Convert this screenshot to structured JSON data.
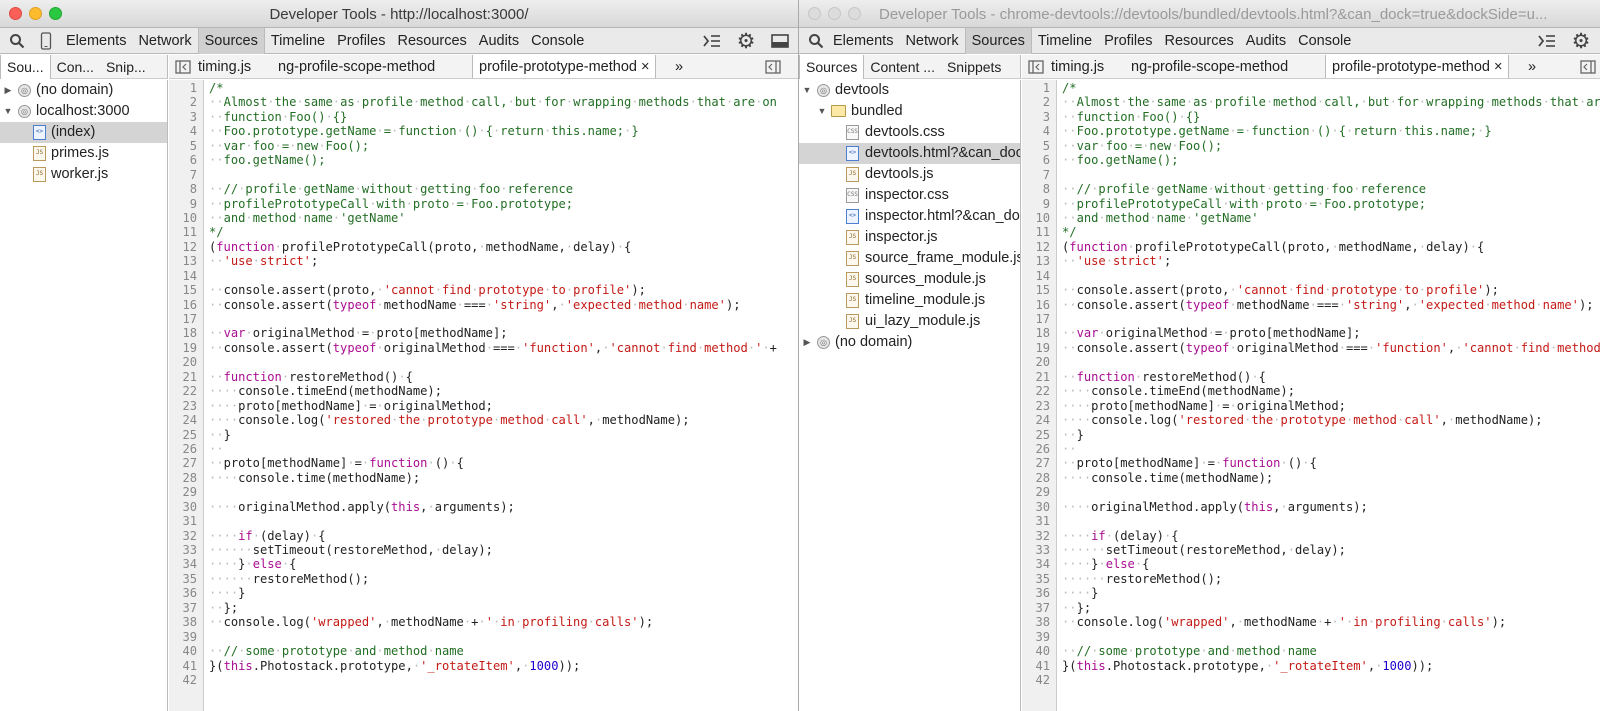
{
  "window_left": {
    "title": "Developer Tools - http://localhost:3000/",
    "panel_tabs": [
      "Elements",
      "Network",
      "Sources",
      "Timeline",
      "Profiles",
      "Resources",
      "Audits",
      "Console"
    ],
    "selected_panel": "Sources",
    "navigator_tabs": [
      "Sou...",
      "Con...",
      "Snip..."
    ],
    "tree": [
      {
        "label": "(no domain)"
      },
      {
        "label": "localhost:3000"
      },
      {
        "label": "(index)"
      },
      {
        "label": "primes.js"
      },
      {
        "label": "worker.js"
      }
    ],
    "editor_tabs": [
      "timing.js",
      "ng-profile-scope-method",
      "profile-prototype-method"
    ],
    "close_glyph": "×",
    "more_glyph": "»"
  },
  "window_right": {
    "title": "Developer Tools - chrome-devtools://devtools/bundled/devtools.html?&can_dock=true&dockSide=u...",
    "panel_tabs": [
      "Elements",
      "Network",
      "Sources",
      "Timeline",
      "Profiles",
      "Resources",
      "Audits",
      "Console"
    ],
    "selected_panel": "Sources",
    "navigator_tabs": [
      "Sources",
      "Content ...",
      "Snippets"
    ],
    "tree": [
      {
        "label": "devtools"
      },
      {
        "label": "bundled"
      },
      {
        "label": "devtools.css"
      },
      {
        "label": "devtools.html?&can_doc"
      },
      {
        "label": "devtools.js"
      },
      {
        "label": "inspector.css"
      },
      {
        "label": "inspector.html?&can_do"
      },
      {
        "label": "inspector.js"
      },
      {
        "label": "source_frame_module.js"
      },
      {
        "label": "sources_module.js"
      },
      {
        "label": "timeline_module.js"
      },
      {
        "label": "ui_lazy_module.js"
      },
      {
        "label": "(no domain)"
      }
    ],
    "editor_tabs": [
      "timing.js",
      "ng-profile-scope-method",
      "profile-prototype-method"
    ],
    "close_glyph": "×",
    "more_glyph": "»"
  },
  "icons": {
    "search": "search-icon",
    "device": "device-mode-icon",
    "drawer": "console-drawer-icon",
    "settings": "gear-icon",
    "dock": "dock-icon",
    "nav_toggle": "toggle-navigator-icon",
    "debugger_toggle": "toggle-debugger-icon"
  },
  "code_lines": [
    "/*",
    "  Almost the same as profile method call, but for wrapping methods that are on",
    "  function Foo() {}",
    "  Foo.prototype.getName = function () { return this.name; }",
    "  var foo = new Foo();",
    "  foo.getName();",
    "",
    "  // profile getName without getting foo reference",
    "  profilePrototypeCall with proto = Foo.prototype;",
    "  and method name 'getName'",
    "*/",
    "(function profilePrototypeCall(proto, methodName, delay) {",
    "  'use strict';",
    "",
    "  console.assert(proto, 'cannot find prototype to profile');",
    "  console.assert(typeof methodName === 'string', 'expected method name');",
    "",
    "  var originalMethod = proto[methodName];",
    "  console.assert(typeof originalMethod === 'function', 'cannot find method ' +",
    "",
    "  function restoreMethod() {",
    "    console.timeEnd(methodName);",
    "    proto[methodName] = originalMethod;",
    "    console.log('restored the prototype method call', methodName);",
    "  }",
    "  ",
    "  proto[methodName] = function () {",
    "    console.time(methodName);",
    "",
    "    originalMethod.apply(this, arguments);",
    "",
    "    if (delay) {",
    "      setTimeout(restoreMethod, delay);",
    "    } else {",
    "      restoreMethod();",
    "    }",
    "  };",
    "  console.log('wrapped', methodName + ' in profiling calls');",
    "",
    "  // some prototype and method name",
    "}(this.Photostack.prototype, '_rotateItem', 1000));",
    ""
  ],
  "colors": {
    "keyword": "#aa0d91",
    "comment": "#236e25",
    "string": "#c41a16",
    "number": "#1c00cf"
  }
}
